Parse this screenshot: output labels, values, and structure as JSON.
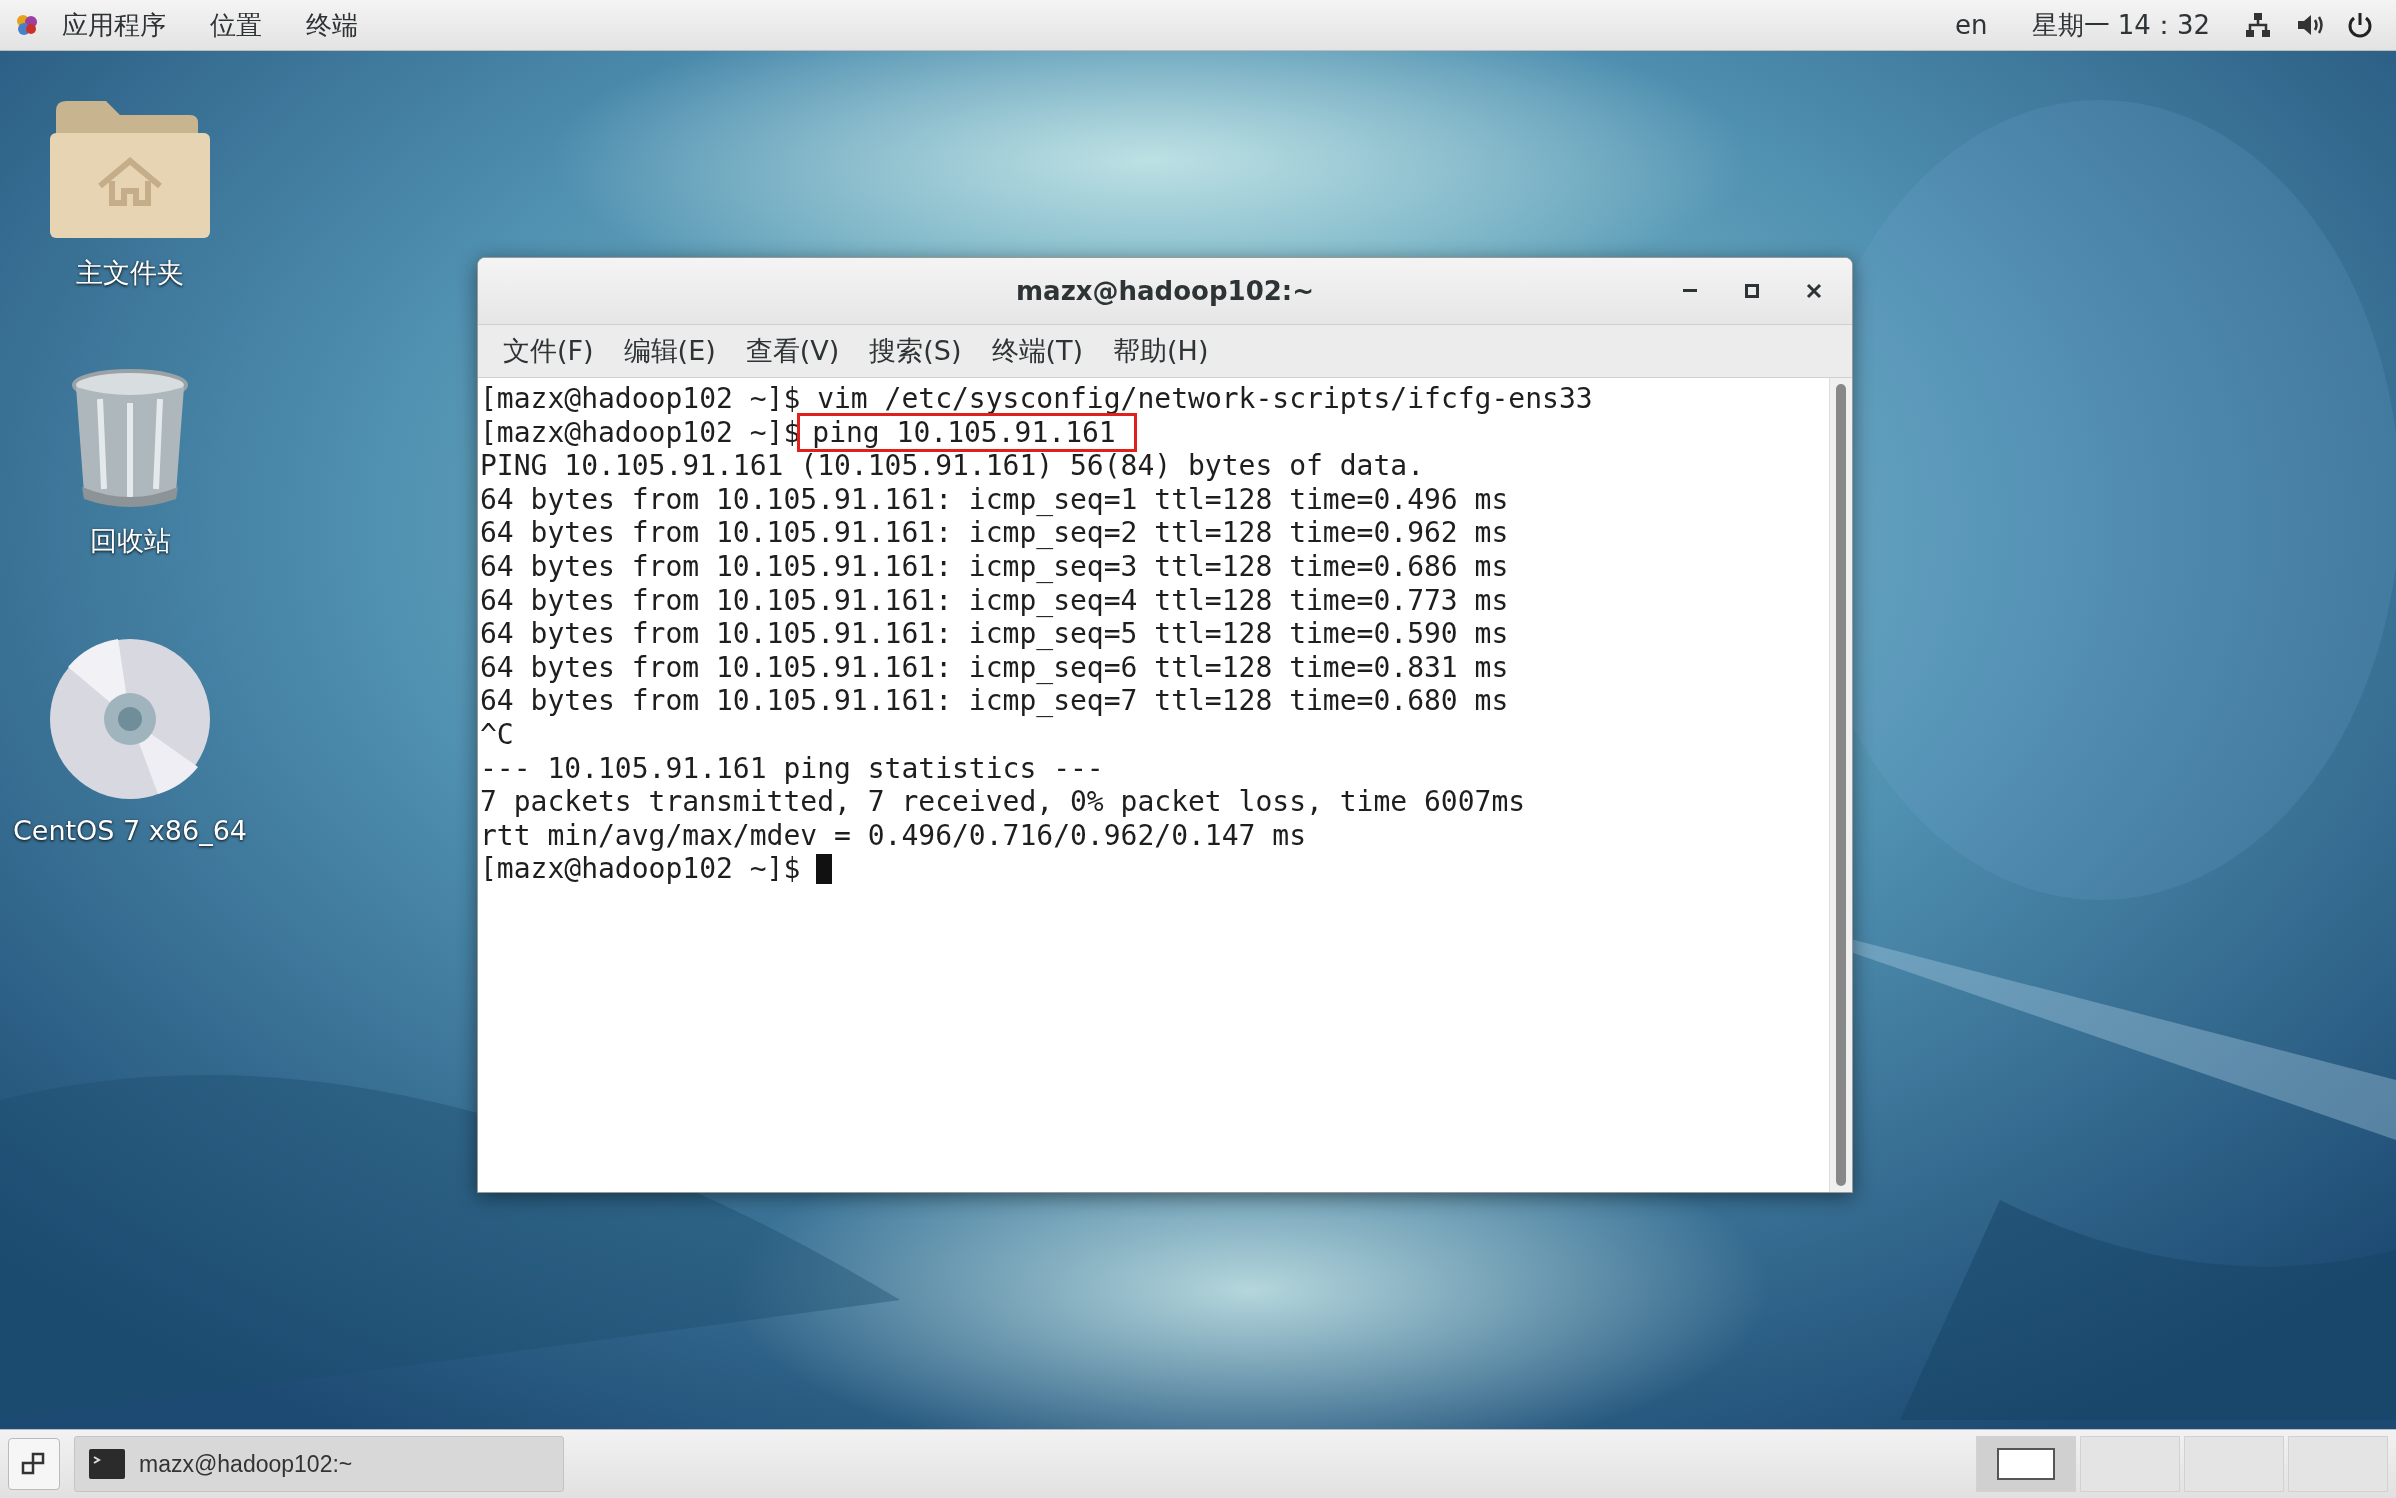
{
  "top_bar": {
    "menus": [
      {
        "label": "应用程序"
      },
      {
        "label": "位置"
      },
      {
        "label": "终端"
      }
    ],
    "language": "en",
    "clock": "星期一 14：32"
  },
  "desktop_icons": [
    {
      "kind": "home-folder",
      "label": "主文件夹"
    },
    {
      "kind": "trash",
      "label": "回收站"
    },
    {
      "kind": "disc",
      "label": "CentOS 7 x86_64"
    }
  ],
  "terminal": {
    "title": "mazx@hadoop102:~",
    "menu": [
      {
        "label": "文件(F)"
      },
      {
        "label": "编辑(E)"
      },
      {
        "label": "查看(V)"
      },
      {
        "label": "搜索(S)"
      },
      {
        "label": "终端(T)"
      },
      {
        "label": "帮助(H)"
      }
    ],
    "lines": [
      {
        "kind": "prompt",
        "prompt": "[mazx@hadoop102 ~]$",
        "command": "vim /etc/sysconfig/network-scripts/ifcfg-ens33"
      },
      {
        "kind": "prompt",
        "prompt": "[mazx@hadoop102 ~]$",
        "command": "ping 10.105.91.161",
        "highlighted": true
      },
      {
        "kind": "output",
        "text": "PING 10.105.91.161 (10.105.91.161) 56(84) bytes of data."
      },
      {
        "kind": "output",
        "text": "64 bytes from 10.105.91.161: icmp_seq=1 ttl=128 time=0.496 ms"
      },
      {
        "kind": "output",
        "text": "64 bytes from 10.105.91.161: icmp_seq=2 ttl=128 time=0.962 ms"
      },
      {
        "kind": "output",
        "text": "64 bytes from 10.105.91.161: icmp_seq=3 ttl=128 time=0.686 ms"
      },
      {
        "kind": "output",
        "text": "64 bytes from 10.105.91.161: icmp_seq=4 ttl=128 time=0.773 ms"
      },
      {
        "kind": "output",
        "text": "64 bytes from 10.105.91.161: icmp_seq=5 ttl=128 time=0.590 ms"
      },
      {
        "kind": "output",
        "text": "64 bytes from 10.105.91.161: icmp_seq=6 ttl=128 time=0.831 ms"
      },
      {
        "kind": "output",
        "text": "64 bytes from 10.105.91.161: icmp_seq=7 ttl=128 time=0.680 ms"
      },
      {
        "kind": "output",
        "text": "^C"
      },
      {
        "kind": "output",
        "text": "--- 10.105.91.161 ping statistics ---"
      },
      {
        "kind": "output",
        "text": "7 packets transmitted, 7 received, 0% packet loss, time 6007ms"
      },
      {
        "kind": "output",
        "text": "rtt min/avg/max/mdev = 0.496/0.716/0.962/0.147 ms"
      },
      {
        "kind": "prompt",
        "prompt": "[mazx@hadoop102 ~]$",
        "cursor": true
      }
    ]
  },
  "taskbar": {
    "tasks": [
      {
        "label": "mazx@hadoop102:~",
        "selected": false
      }
    ],
    "workspaces": [
      {
        "selected": true
      },
      {
        "selected": false
      },
      {
        "selected": false
      },
      {
        "selected": false
      }
    ]
  }
}
